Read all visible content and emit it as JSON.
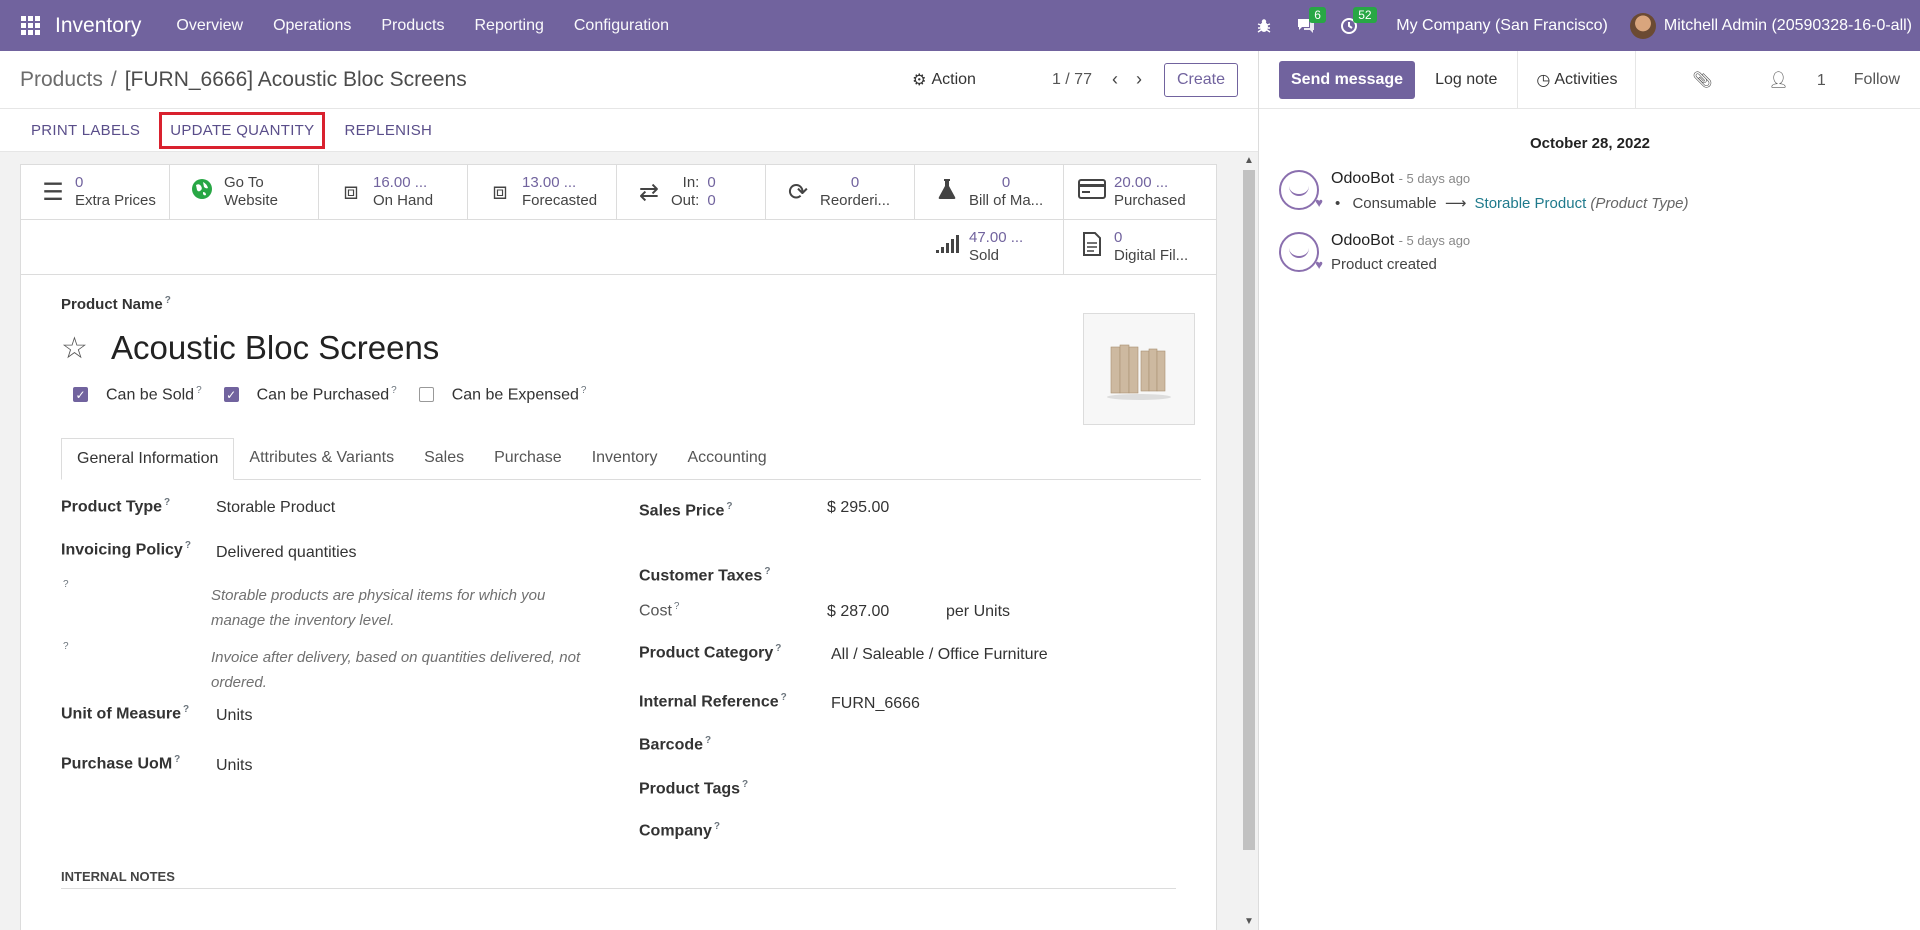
{
  "topnav": {
    "app": "Inventory",
    "menu": [
      "Overview",
      "Operations",
      "Products",
      "Reporting",
      "Configuration"
    ],
    "chat_count": "6",
    "activity_count": "52",
    "company": "My Company (San Francisco)",
    "user": "Mitchell Admin (20590328-16-0-all)"
  },
  "control": {
    "breadcrumb_parent": "Products",
    "breadcrumb_current": "[FURN_6666] Acoustic Bloc Screens",
    "action": "Action",
    "pager": "1 / 77",
    "create": "Create"
  },
  "status_buttons": [
    "PRINT LABELS",
    "UPDATE QUANTITY",
    "REPLENISH"
  ],
  "smart_buttons": {
    "extra_prices": {
      "value": "0",
      "label": "Extra Prices"
    },
    "website": {
      "value": "Go To",
      "label": "Website"
    },
    "on_hand": {
      "value": "16.00 ...",
      "label": "On Hand"
    },
    "forecasted": {
      "value": "13.00 ...",
      "label": "Forecasted"
    },
    "in_out": {
      "in_label": "In:",
      "in_value": "0",
      "out_label": "Out:",
      "out_value": "0"
    },
    "reordering": {
      "value": "0",
      "label": "Reorderi..."
    },
    "bom": {
      "value": "0",
      "label": "Bill of Ma..."
    },
    "purchased": {
      "value": "20.00 ...",
      "label": "Purchased"
    },
    "sold": {
      "value": "47.00 ...",
      "label": "Sold"
    },
    "digital": {
      "value": "0",
      "label": "Digital Fil..."
    }
  },
  "form": {
    "product_name_label": "Product Name",
    "product_name": "Acoustic Bloc Screens",
    "can_be_sold": "Can be Sold",
    "can_be_purchased": "Can be Purchased",
    "can_be_expensed": "Can be Expensed",
    "tabs": [
      "General Information",
      "Attributes & Variants",
      "Sales",
      "Purchase",
      "Inventory",
      "Accounting"
    ],
    "product_type_label": "Product Type",
    "product_type": "Storable Product",
    "invoicing_policy_label": "Invoicing Policy",
    "invoicing_policy": "Delivered quantities",
    "help_type": "Storable products are physical items for which you manage the inventory level.",
    "help_invoice": "Invoice after delivery, based on quantities delivered, not ordered.",
    "uom_label": "Unit of Measure",
    "uom": "Units",
    "purchase_uom_label": "Purchase UoM",
    "purchase_uom": "Units",
    "sales_price_label": "Sales Price",
    "sales_price": "$ 295.00",
    "customer_taxes_label": "Customer Taxes",
    "cost_label": "Cost",
    "cost": "$ 287.00",
    "per_units": "per Units",
    "category_label": "Product Category",
    "category": "All / Saleable / Office Furniture",
    "internal_ref_label": "Internal Reference",
    "internal_ref": "FURN_6666",
    "barcode_label": "Barcode",
    "tags_label": "Product Tags",
    "company_label": "Company",
    "internal_notes": "INTERNAL NOTES"
  },
  "chatter": {
    "send_message": "Send message",
    "log_note": "Log note",
    "activities": "Activities",
    "followers": "1",
    "follow": "Follow",
    "date": "October 28, 2022",
    "messages": [
      {
        "author": "OdooBot",
        "ago": "- 5 days ago",
        "old": "Consumable",
        "new": "Storable Product",
        "field": "(Product Type)"
      },
      {
        "author": "OdooBot",
        "ago": "- 5 days ago",
        "text": "Product created"
      }
    ]
  },
  "colors": {
    "brand": "#71639e",
    "highlight": "#d9212e",
    "badge": "#28a745"
  }
}
